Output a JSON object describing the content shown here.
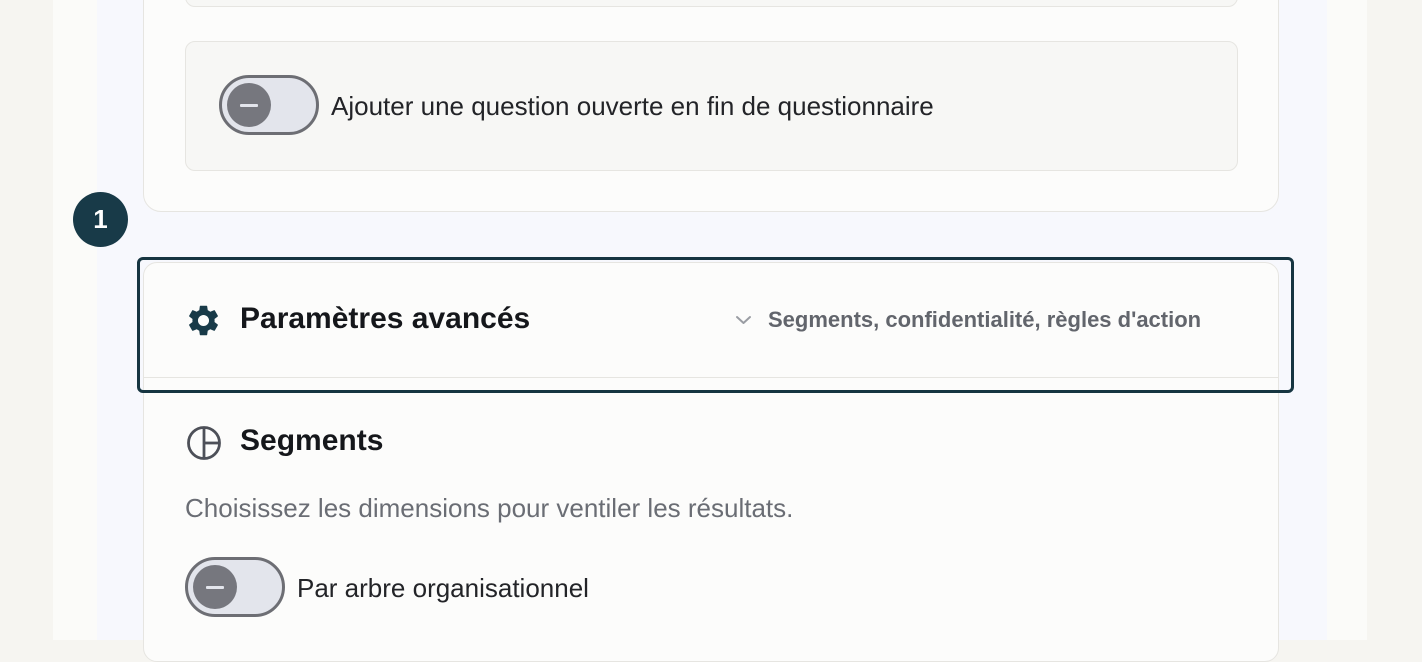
{
  "questionnaire": {
    "open_question_toggle": {
      "label": "Ajouter une question ouverte en fin de questionnaire",
      "checked": false
    }
  },
  "step_badge": "1",
  "advanced_settings": {
    "title": "Paramètres avancés",
    "summary": "Segments, confidentialité, règles d'action",
    "icon": "gear-icon",
    "expanded": true
  },
  "segments": {
    "title": "Segments",
    "icon": "pie-chart-icon",
    "description": "Choisissez les dimensions pour ventiler les résultats.",
    "org_tree_toggle": {
      "label": "Par arbre organisationnel",
      "checked": false
    }
  },
  "colors": {
    "accent": "#183a48",
    "toggle_off": "#76777e",
    "toggle_track": "#e3e5ec"
  }
}
